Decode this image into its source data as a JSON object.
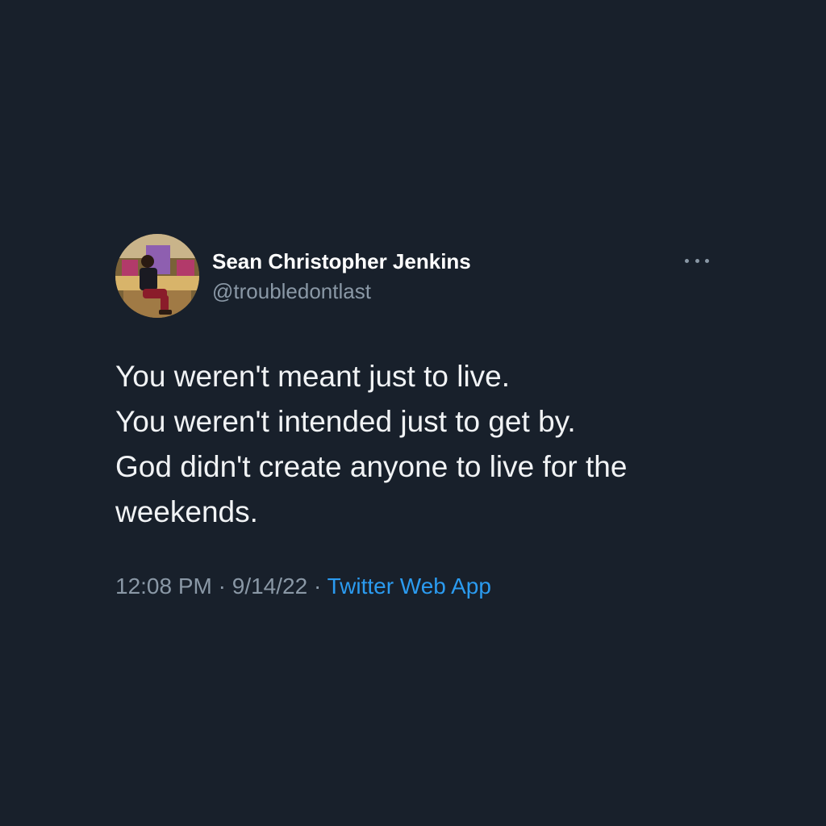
{
  "tweet": {
    "display_name": "Sean Christopher Jenkins",
    "handle": "@troubledontlast",
    "avatar_icon": "profile-photo",
    "more_icon": "ellipsis-icon",
    "lines": [
      "You weren't meant just to live.",
      "You weren't intended just to get by.",
      "God didn't create anyone to live for the",
      "weekends."
    ],
    "time": "12:08 PM",
    "separator": "·",
    "date": "9/14/22",
    "source": "Twitter Web App"
  },
  "colors": {
    "background": "#18202b",
    "text": "#f1f3f5",
    "muted": "#8a98a6",
    "link": "#2b9bf0"
  }
}
